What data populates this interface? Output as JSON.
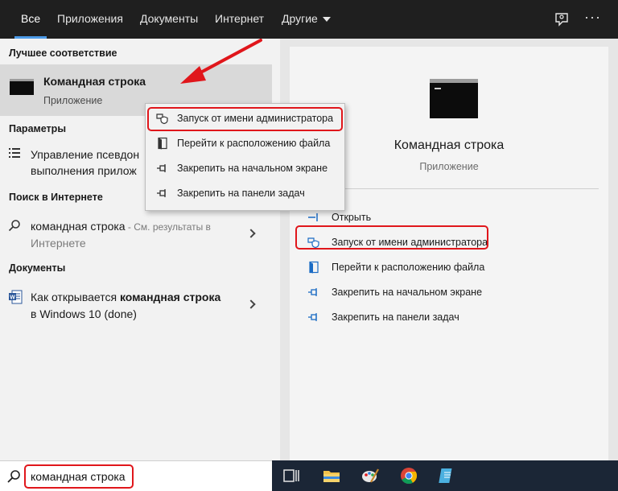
{
  "tabs": {
    "all": "Все",
    "apps": "Приложения",
    "documents": "Документы",
    "internet": "Интернет",
    "other": "Другие"
  },
  "left": {
    "best_match_title": "Лучшее соответствие",
    "best_match": {
      "title": "Командная строка",
      "subtitle": "Приложение"
    },
    "settings_title": "Параметры",
    "settings_item": {
      "line1": "Управление псевдон",
      "line2": "выполнения прилож"
    },
    "web_title": "Поиск в Интернете",
    "web_item": {
      "query": "командная строка",
      "suffix": " - См. результаты в",
      "line2": "Интернете"
    },
    "docs_title": "Документы",
    "doc_item": {
      "prefix": "Как открывается ",
      "bold": "командная строка",
      "line2": "в Windows 10 (done)"
    }
  },
  "context_menu": {
    "run_as_admin": "Запуск от имени администратора",
    "open_location": "Перейти к расположению файла",
    "pin_start": "Закрепить на начальном экране",
    "pin_taskbar": "Закрепить на панели задач"
  },
  "right": {
    "name": "Командная строка",
    "type": "Приложение",
    "actions": {
      "open": "Открыть",
      "run_as_admin": "Запуск от имени администратора",
      "open_location": "Перейти к расположению файла",
      "pin_start": "Закрепить на начальном экране",
      "pin_taskbar": "Закрепить на панели задач"
    }
  },
  "search": {
    "query": "командная строка"
  },
  "colors": {
    "highlight_red": "#e0161b",
    "accent_blue": "#4c9be8",
    "topbar": "#1f1f1f",
    "taskbar": "#1b2636"
  }
}
